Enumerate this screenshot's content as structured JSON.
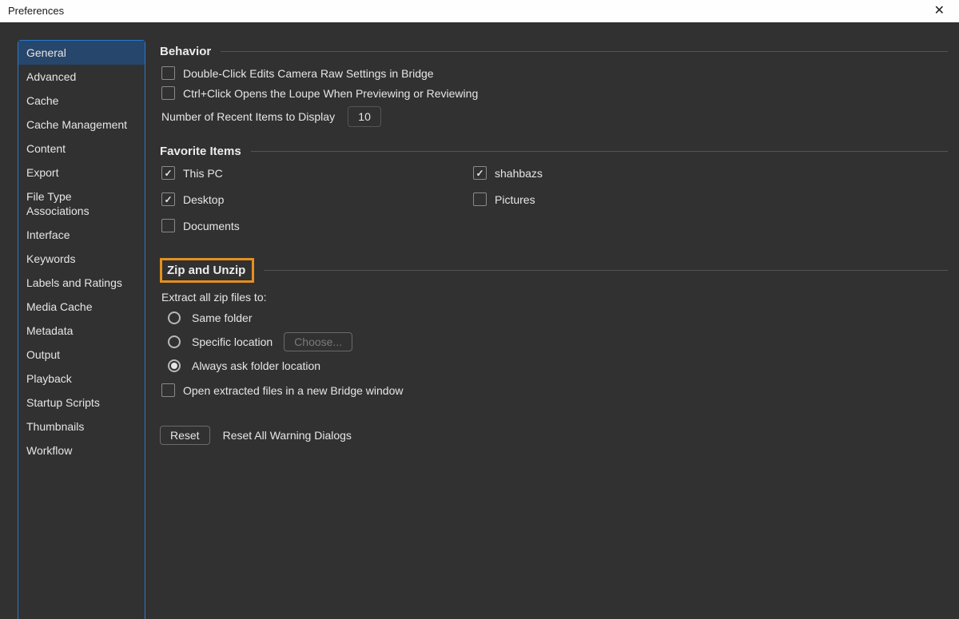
{
  "window": {
    "title": "Preferences"
  },
  "sidebar": {
    "items": [
      "General",
      "Advanced",
      "Cache",
      "Cache Management",
      "Content",
      "Export",
      "File Type Associations",
      "Interface",
      "Keywords",
      "Labels and Ratings",
      "Media Cache",
      "Metadata",
      "Output",
      "Playback",
      "Startup Scripts",
      "Thumbnails",
      "Workflow"
    ],
    "selected": 0
  },
  "sections": {
    "behavior": {
      "title": "Behavior",
      "doubleClick": {
        "label": "Double-Click Edits Camera Raw Settings in Bridge",
        "checked": false
      },
      "ctrlClick": {
        "label": "Ctrl+Click Opens the Loupe When Previewing or Reviewing",
        "checked": false
      },
      "recentLabel": "Number of Recent Items to Display",
      "recentValue": "10"
    },
    "favorites": {
      "title": "Favorite Items",
      "items": [
        {
          "label": "This PC",
          "checked": true
        },
        {
          "label": "shahbazs",
          "checked": true
        },
        {
          "label": "Desktop",
          "checked": true
        },
        {
          "label": "Pictures",
          "checked": false
        },
        {
          "label": "Documents",
          "checked": false
        }
      ]
    },
    "zip": {
      "title": "Zip and Unzip",
      "extractLabel": "Extract all zip files to:",
      "radios": [
        {
          "label": "Same folder"
        },
        {
          "label": "Specific location"
        },
        {
          "label": "Always ask folder location"
        }
      ],
      "selectedRadio": 2,
      "chooseBtn": "Choose...",
      "openExtracted": {
        "label": "Open extracted files in a new Bridge window",
        "checked": false
      }
    },
    "footer": {
      "resetBtn": "Reset",
      "resetDialogs": "Reset All Warning Dialogs"
    }
  }
}
